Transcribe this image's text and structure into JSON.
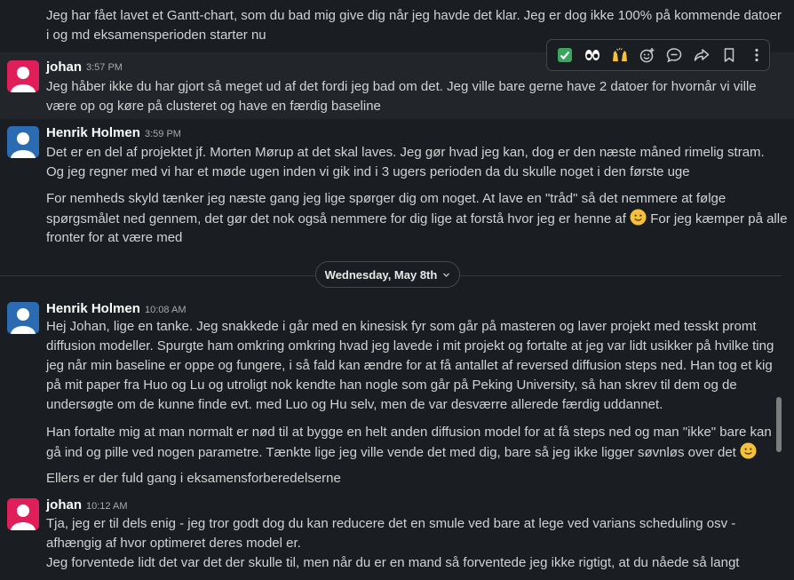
{
  "messages": [
    {
      "lines": [
        "Jeg har fået lavet et Gantt-chart, som du bad mig give dig når jeg havde det klar. Jeg er dog ikke 100% på kommende datoer",
        "i og md eksamensperioden starter nu"
      ]
    },
    {
      "author": "johan",
      "time": "3:57 PM",
      "lines": [
        "Jeg håber ikke du har gjort så meget ud af det fordi jeg bad om det. Jeg ville bare gerne have 2 datoer for hvornår vi ville",
        "være op og køre på clusteret og have en færdig baseline"
      ]
    },
    {
      "author": "Henrik Holmen",
      "time": "3:59 PM",
      "lines": [
        "Det er en del af projektet jf. Morten Mørup at det skal laves. Jeg gør hvad jeg kan, dog er den næste måned rimelig stram.",
        "Og jeg regner med vi har et møde ugen inden vi gik ind i 3 ugers perioden da du skulle noget i den første uge"
      ],
      "para2_lines": [
        "For nemheds skyld tænker jeg næste gang jeg lige spørger dig om noget. At lave en \"tråd\" så det nemmere at følge",
        "spørgsmålet ned gennem, det gør det nok også nemmere for dig lige at forstå hvor jeg er henne af",
        "For jeg kæmper på alle",
        "fronter for at være med"
      ]
    },
    {
      "author": "Henrik Holmen",
      "time": "10:08 AM",
      "lines": [
        "Hej Johan, lige en tanke. Jeg snakkede i går med en kinesisk fyr som går på masteren og laver projekt med tesskt promt",
        "diffusion modeller. Spurgte ham omkring omkring hvad jeg lavede i mit projekt og fortalte at jeg var lidt usikker på hvilke ting",
        "jeg når min baseline er oppe og fungere, i så fald kan ændre for at få antallet af reversed diffusion steps ned. Han tog et kig",
        "på mit paper fra Huo og Lu og utroligt nok kendte han nogle som går på Peking University, så han skrev til dem og de",
        "undersøgte om de kunne finde evt. med Luo og Hu selv, men de var desværre allerede færdig uddannet."
      ],
      "para2_lines": [
        "Han fortalte mig at man normalt er nød til at bygge en helt anden diffusion model for at få steps ned og man \"ikke\" bare kan",
        "gå ind og pille ved nogen parametre. Tænkte lige jeg ville vende det med dig, bare så jeg ikke ligger søvnløs over det"
      ],
      "para3": "Ellers er der fuld gang i eksamensforberedelserne"
    },
    {
      "author": "johan",
      "time": "10:12 AM",
      "lines": [
        "Tja, jeg er til dels enig - jeg tror godt dog du kan reducere det en smule ved bare at lege ved varians scheduling osv -",
        "afhængig af hvor optimeret deres model er.",
        "Jeg forventede lidt det var det der skulle til, men når du er en mand så forventede jeg ikke rigtigt, at du nåede så langt"
      ]
    }
  ],
  "divider": {
    "label": "Wednesday, May 8th"
  },
  "toolbar": [
    "check-mark-emoji",
    "eyes-emoji",
    "raised-hands-emoji",
    "add-reaction-icon",
    "reply-in-thread-icon",
    "share-icon",
    "bookmark-icon",
    "more-actions-icon"
  ],
  "colors": {
    "johan_avatar": "#e01e5a",
    "henrik_avatar": "#2a6bb2",
    "background": "#1a1d21",
    "hover": "#222529"
  }
}
